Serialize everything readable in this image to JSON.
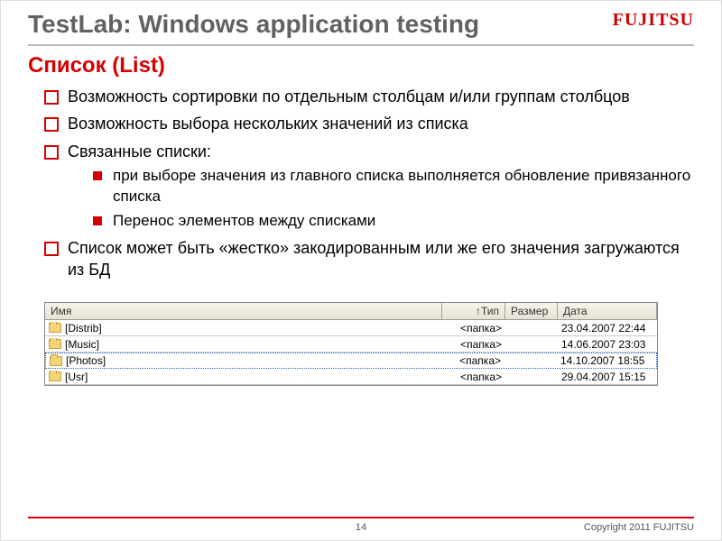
{
  "header": {
    "title": "TestLab: Windows application testing",
    "logo": "FUJITSU"
  },
  "section": "Список (List)",
  "bullets": [
    {
      "text": "Возможность сортировки по отдельным столбцам и/или группам столбцов"
    },
    {
      "text": "Возможность выбора нескольких значений из списка"
    },
    {
      "text": "Связанные списки:",
      "sub": [
        "при выборе значения из главного списка выполняется обновление привязанного списка",
        "Перенос элементов между списками"
      ]
    },
    {
      "text": "Список может быть «жестко» закодированным или же его значения загружаются из БД"
    }
  ],
  "table": {
    "headers": {
      "name": "Имя",
      "type": "↑Тип",
      "size": "Размер",
      "date": "Дата"
    },
    "rows": [
      {
        "name": "[Distrib]",
        "type": "<папка>",
        "size": "",
        "date": "23.04.2007 22:44",
        "sel": false
      },
      {
        "name": "[Music]",
        "type": "<папка>",
        "size": "",
        "date": "14.06.2007 23:03",
        "sel": false
      },
      {
        "name": "[Photos]",
        "type": "<папка>",
        "size": "",
        "date": "14.10.2007 18:55",
        "sel": true
      },
      {
        "name": "[Usr]",
        "type": "<папка>",
        "size": "",
        "date": "29.04.2007 15:15",
        "sel": false
      }
    ]
  },
  "footer": {
    "page": "14",
    "copyright": "Copyright 2011 FUJITSU"
  }
}
